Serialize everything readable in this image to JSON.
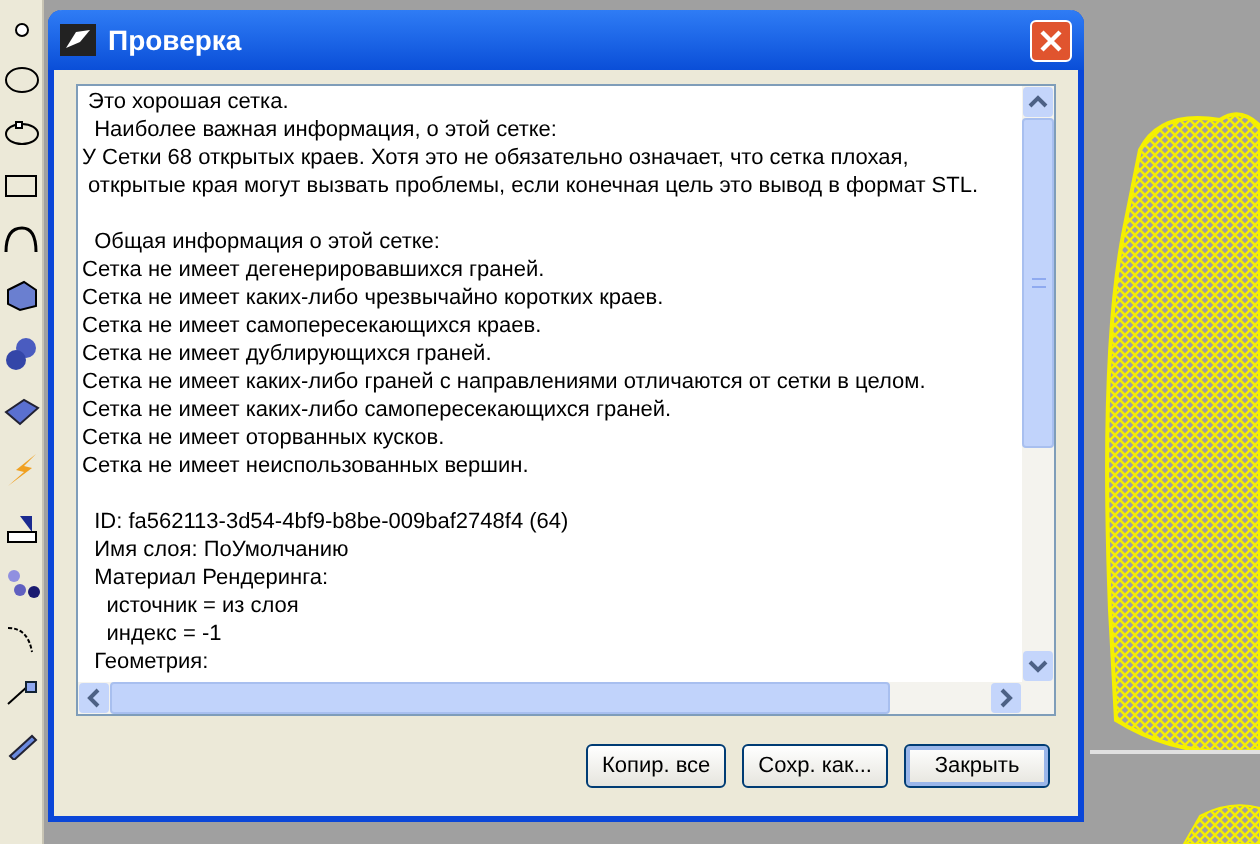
{
  "window": {
    "title": "Проверка"
  },
  "report": {
    "paragraphs": [
      [
        " Это хорошая сетка.",
        "  Наиболее важная информация, о этой сетке:",
        "У Сетки 68 открытых краев. Хотя это не обязательно означает, что сетка плохая,",
        " открытые края могут вызвать проблемы, если конечная цель это вывод в формат STL."
      ],
      [
        "  Общая информация о этой сетке:",
        "Сетка не имеет дегенерировавшихся граней.",
        "Сетка не имеет каких-либо чрезвычайно коротких краев.",
        "Сетка не имеет самопересекающихся краев.",
        "Сетка не имеет дублирующихся граней.",
        "Сетка не имеет каких-либо граней с направлениями отличаются от сетки в целом.",
        "Сетка не имеет каких-либо самопересекающихся граней.",
        "Сетка не имеет оторванных кусков.",
        "Сетка не имеет неиспользованных вершин."
      ],
      [
        "  ID: fa562113-3d54-4bf9-b8be-009baf2748f4 (64)",
        "  Имя слоя: ПоУмолчанию",
        "  Материал Рендеринга:",
        "    источник = из слоя",
        "    индекс = -1",
        "  Геометрия:"
      ]
    ]
  },
  "buttons": [
    {
      "label": "Копир. все",
      "default": false
    },
    {
      "label": "Сохр. как...",
      "default": false
    },
    {
      "label": "Закрыть",
      "default": true
    }
  ]
}
